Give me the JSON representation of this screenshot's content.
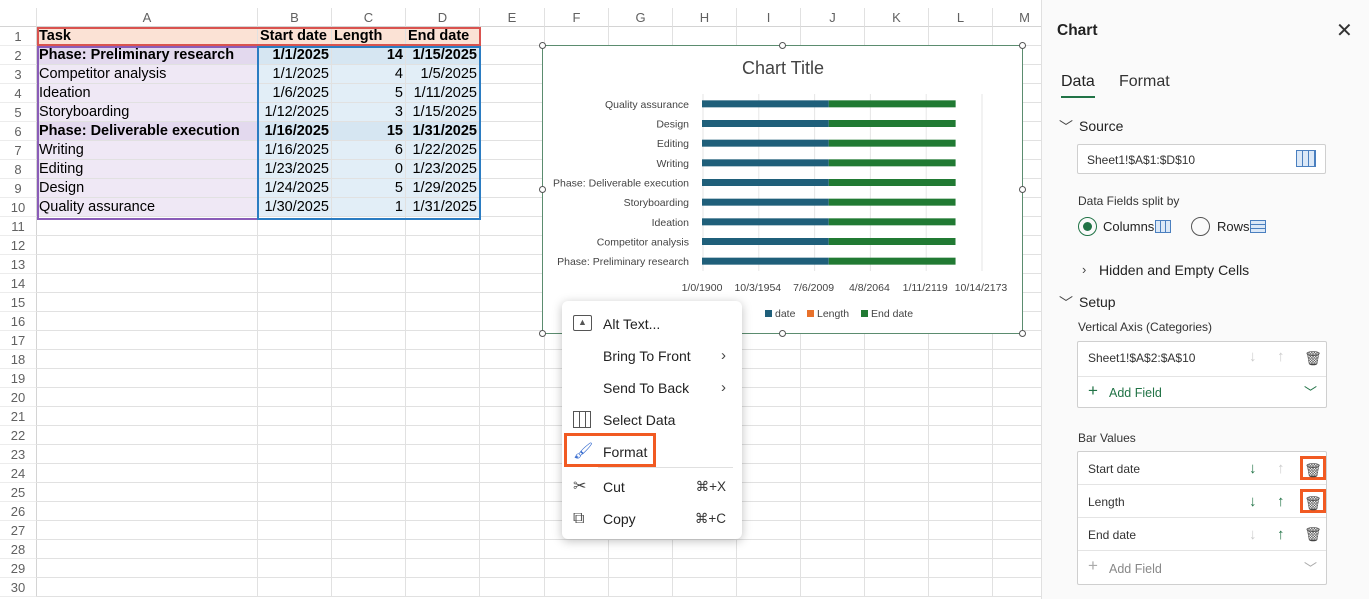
{
  "sheet": {
    "columns": [
      "A",
      "B",
      "C",
      "D",
      "E",
      "F",
      "G",
      "H",
      "I",
      "J",
      "K",
      "L",
      "M"
    ],
    "rows": [
      "1",
      "2",
      "3",
      "4",
      "5",
      "6",
      "7",
      "8",
      "9",
      "10",
      "11",
      "12",
      "13",
      "14",
      "15",
      "16",
      "17",
      "18",
      "19",
      "20",
      "21",
      "22",
      "23",
      "24",
      "25",
      "26",
      "27",
      "28",
      "29",
      "30"
    ],
    "header": {
      "task": "Task",
      "start": "Start date",
      "length": "Length",
      "end": "End date"
    },
    "data": [
      {
        "task": "Phase: Preliminary research",
        "start": "1/1/2025",
        "length": "14",
        "end": "1/15/2025",
        "bold": true
      },
      {
        "task": "Competitor analysis",
        "start": "1/1/2025",
        "length": "4",
        "end": "1/5/2025",
        "bold": false
      },
      {
        "task": "Ideation",
        "start": "1/6/2025",
        "length": "5",
        "end": "1/11/2025",
        "bold": false
      },
      {
        "task": "Storyboarding",
        "start": "1/12/2025",
        "length": "3",
        "end": "1/15/2025",
        "bold": false
      },
      {
        "task": "Phase: Deliverable execution",
        "start": "1/16/2025",
        "length": "15",
        "end": "1/31/2025",
        "bold": true
      },
      {
        "task": "Writing",
        "start": "1/16/2025",
        "length": "6",
        "end": "1/22/2025",
        "bold": false
      },
      {
        "task": "Editing",
        "start": "1/23/2025",
        "length": "0",
        "end": "1/23/2025",
        "bold": false
      },
      {
        "task": "Design",
        "start": "1/24/2025",
        "length": "5",
        "end": "1/29/2025",
        "bold": false
      },
      {
        "task": "Quality assurance",
        "start": "1/30/2025",
        "length": "1",
        "end": "1/31/2025",
        "bold": false
      }
    ]
  },
  "chart_data": {
    "type": "bar",
    "orientation": "horizontal",
    "stacked": true,
    "title": "Chart Title",
    "categories": [
      "Phase: Preliminary research",
      "Competitor analysis",
      "Ideation",
      "Storyboarding",
      "Phase: Deliverable execution",
      "Writing",
      "Editing",
      "Design",
      "Quality assurance"
    ],
    "x_tick_labels": [
      "1/0/1900",
      "10/3/1954",
      "7/6/2009",
      "4/8/2064",
      "1/11/2119",
      "10/14/2173"
    ],
    "series": [
      {
        "name": "Start date",
        "values": [
          45658,
          45658,
          45663,
          45669,
          45673,
          45673,
          45680,
          45681,
          45687
        ],
        "color": "#1f5f7a"
      },
      {
        "name": "Length",
        "values": [
          14,
          4,
          5,
          3,
          15,
          6,
          0,
          5,
          1
        ],
        "color": "#e8712b"
      },
      {
        "name": "End date",
        "values": [
          45672,
          45662,
          45668,
          45672,
          45688,
          45679,
          45680,
          45686,
          45688
        ],
        "color": "#217a33"
      }
    ],
    "legend_items": [
      {
        "label": "date",
        "color": "#1f5f7a"
      },
      {
        "label": "Length",
        "color": "#e8712b"
      },
      {
        "label": "End date",
        "color": "#217a33"
      }
    ],
    "legend_position": "bottom"
  },
  "context_menu": {
    "items": [
      {
        "label": "Alt Text...",
        "icon": "alt-text-icon",
        "shortcut": "",
        "submenu": false
      },
      {
        "label": "Bring To Front",
        "icon": "",
        "shortcut": "",
        "submenu": true
      },
      {
        "label": "Send To Back",
        "icon": "",
        "shortcut": "",
        "submenu": true
      },
      {
        "label": "Select Data",
        "icon": "select-data-icon",
        "shortcut": "",
        "submenu": false
      },
      {
        "label": "Format",
        "icon": "format-brush-icon",
        "shortcut": "",
        "submenu": false
      },
      {
        "label": "Cut",
        "icon": "scissors-icon",
        "shortcut": "⌘+X",
        "submenu": false
      },
      {
        "label": "Copy",
        "icon": "copy-icon",
        "shortcut": "⌘+C",
        "submenu": false
      }
    ]
  },
  "panel": {
    "title": "Chart",
    "tabs": [
      "Data",
      "Format"
    ],
    "active_tab": "Data",
    "source_label": "Source",
    "source_value": "Sheet1!$A$1:$D$10",
    "split_label": "Data Fields split by",
    "columns_label": "Columns",
    "rows_label": "Rows",
    "hidden_label": "Hidden and Empty Cells",
    "setup_label": "Setup",
    "vaxis_label": "Vertical Axis (Categories)",
    "vaxis_value": "Sheet1!$A$2:$A$10",
    "add_field": "Add Field",
    "bar_values_label": "Bar Values",
    "bar_values": [
      "Start date",
      "Length",
      "End date"
    ],
    "accent": "#217346",
    "highlight": "#f15a22"
  }
}
